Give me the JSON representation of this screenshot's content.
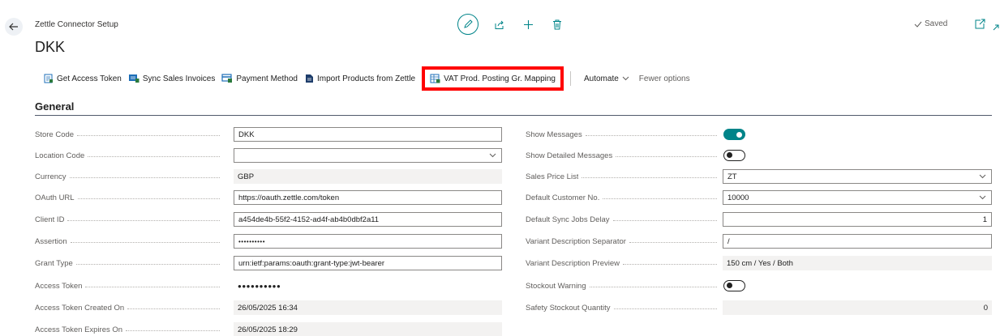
{
  "header": {
    "app_title": "Zettle Connector Setup",
    "page_title": "DKK",
    "status": "Saved"
  },
  "icons": {
    "back": "arrow-left-icon",
    "edit": "pencil-icon",
    "share": "share-icon",
    "new": "plus-icon",
    "delete": "trash-icon",
    "saved": "checkmark-icon",
    "popout": "open-in-new-window-icon",
    "collapse": "collapse-icon"
  },
  "colors": {
    "accent": "#008489",
    "highlight_border": "#ff0000",
    "readonly_bg": "#f3f2f1",
    "icon_blue": "#1e6fb8",
    "icon_green": "#2b7a3d"
  },
  "toolbar": {
    "get_access_token": "Get Access Token",
    "sync_sales_invoices": "Sync Sales Invoices",
    "payment_method": "Payment Method",
    "import_products": "Import Products from Zettle",
    "vat_mapping": "VAT Prod. Posting Gr. Mapping",
    "automate": "Automate",
    "fewer_options": "Fewer options"
  },
  "section": {
    "title": "General"
  },
  "left_fields": {
    "store_code": {
      "label": "Store Code",
      "value": "DKK"
    },
    "location_code": {
      "label": "Location Code",
      "value": ""
    },
    "currency": {
      "label": "Currency",
      "value": "GBP"
    },
    "oauth_url": {
      "label": "OAuth URL",
      "value": "https://oauth.zettle.com/token"
    },
    "client_id": {
      "label": "Client ID",
      "value": "a454de4b-55f2-4152-ad4f-ab4b0dbf2a11"
    },
    "assertion": {
      "label": "Assertion",
      "value": "••••••••••"
    },
    "grant_type": {
      "label": "Grant Type",
      "value": "urn:ietf:params:oauth:grant-type:jwt-bearer"
    },
    "access_token": {
      "label": "Access Token",
      "value": "●●●●●●●●●●"
    },
    "token_created": {
      "label": "Access Token Created On",
      "value": "26/05/2025 16:34"
    },
    "token_expires": {
      "label": "Access Token Expires On",
      "value": "26/05/2025 18:29"
    }
  },
  "right_fields": {
    "show_messages": {
      "label": "Show Messages",
      "on": true
    },
    "show_detailed_messages": {
      "label": "Show Detailed Messages",
      "on": false
    },
    "sales_price_list": {
      "label": "Sales Price List",
      "value": "ZT"
    },
    "default_customer": {
      "label": "Default Customer No.",
      "value": "10000"
    },
    "default_sync_delay": {
      "label": "Default Sync Jobs Delay",
      "value": "1"
    },
    "variant_separator": {
      "label": "Variant Description Separator",
      "value": "/"
    },
    "variant_preview": {
      "label": "Variant Description Preview",
      "value": "150 cm / Yes / Both"
    },
    "stockout_warning": {
      "label": "Stockout Warning",
      "on": false
    },
    "safety_stockout_qty": {
      "label": "Safety Stockout Quantity",
      "value": "0"
    }
  }
}
